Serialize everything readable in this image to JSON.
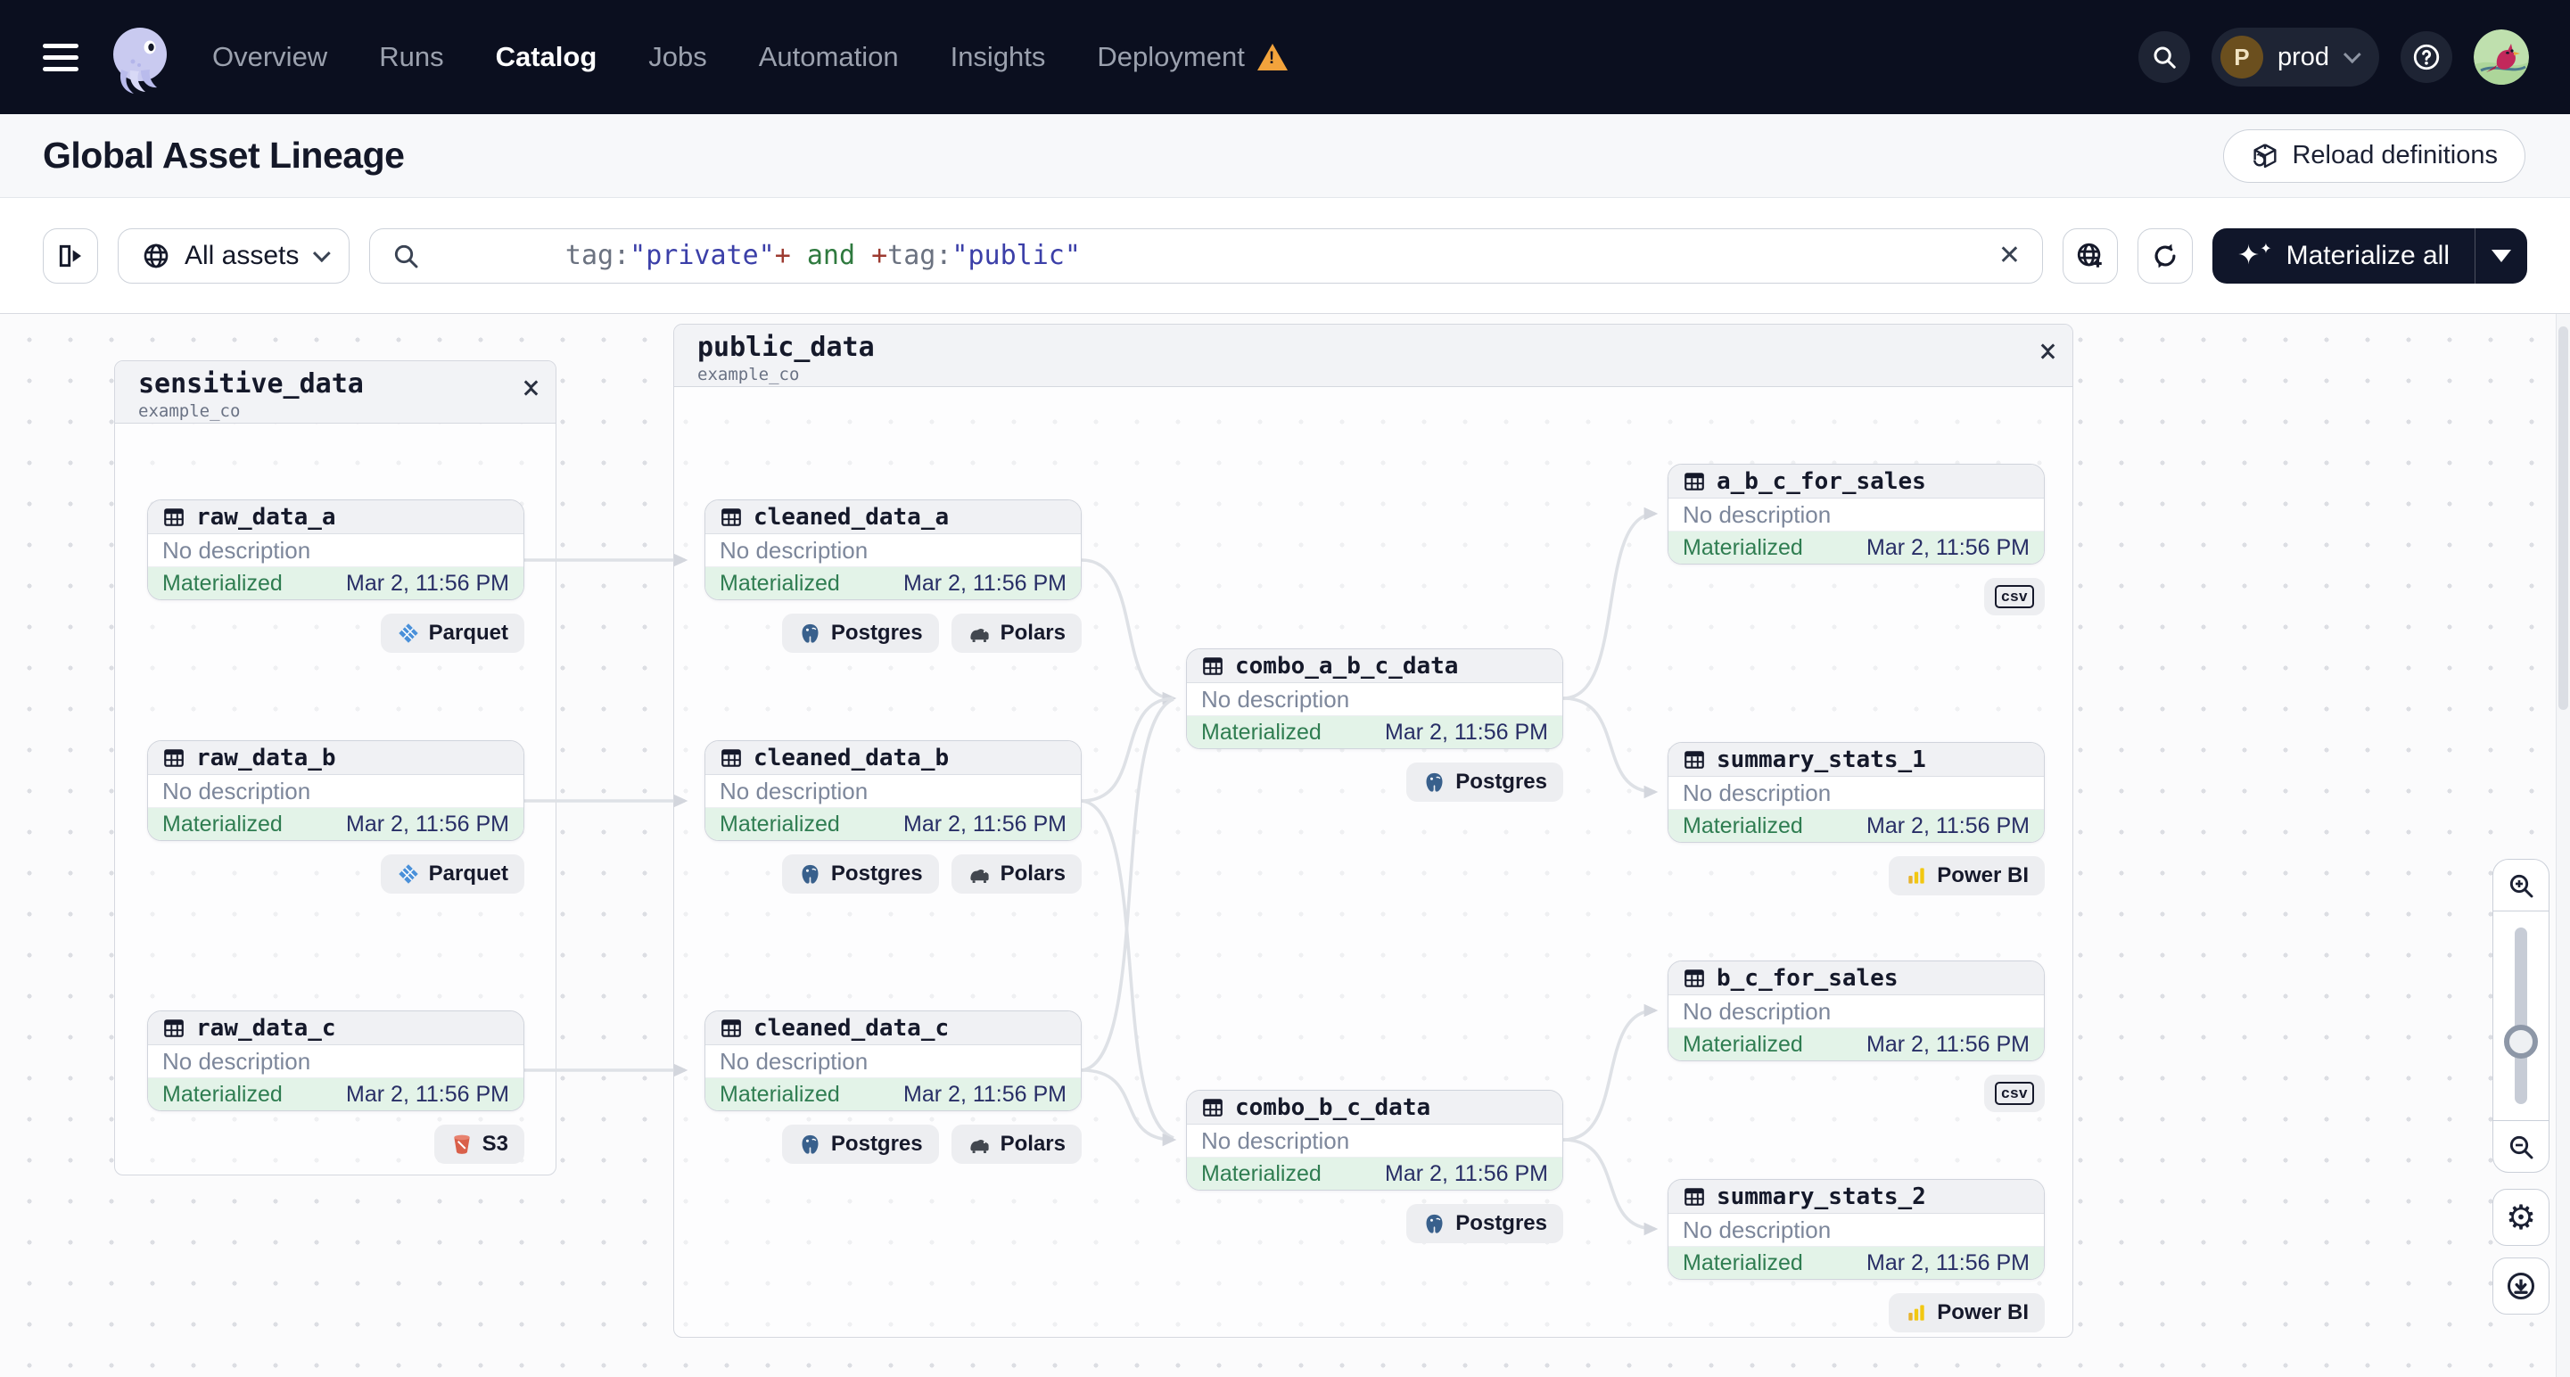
{
  "nav": {
    "items": [
      {
        "label": "Overview"
      },
      {
        "label": "Runs"
      },
      {
        "label": "Catalog"
      },
      {
        "label": "Jobs"
      },
      {
        "label": "Automation"
      },
      {
        "label": "Insights"
      },
      {
        "label": "Deployment"
      }
    ],
    "active": "Catalog",
    "env": {
      "initial": "P",
      "name": "prod"
    }
  },
  "header": {
    "title": "Global Asset Lineage",
    "reload_label": "Reload definitions"
  },
  "toolbar": {
    "scope_label": "All assets",
    "query": [
      {
        "text": "tag:",
        "color": "#6B7280"
      },
      {
        "text": "\"private\"",
        "color": "#3B3FA8"
      },
      {
        "text": "+",
        "color": "#9C3A30"
      },
      {
        "text": " and ",
        "color": "#2F7A3F"
      },
      {
        "text": "+",
        "color": "#9C3A30"
      },
      {
        "text": "tag:",
        "color": "#6B7280"
      },
      {
        "text": "\"public\"",
        "color": "#3B3FA8"
      }
    ],
    "clear_label": "✕",
    "materialize_label": "Materialize all"
  },
  "graph": {
    "groups": [
      {
        "name": "sensitive_data",
        "owner": "example_co"
      },
      {
        "name": "public_data",
        "owner": "example_co"
      }
    ],
    "nodes": [
      {
        "name": "raw_data_a",
        "description": "No description",
        "status": "Materialized",
        "timestamp": "Mar 2, 11:56 PM",
        "badges": [
          "Parquet"
        ]
      },
      {
        "name": "raw_data_b",
        "description": "No description",
        "status": "Materialized",
        "timestamp": "Mar 2, 11:56 PM",
        "badges": [
          "Parquet"
        ]
      },
      {
        "name": "raw_data_c",
        "description": "No description",
        "status": "Materialized",
        "timestamp": "Mar 2, 11:56 PM",
        "badges": [
          "S3"
        ]
      },
      {
        "name": "cleaned_data_a",
        "description": "No description",
        "status": "Materialized",
        "timestamp": "Mar 2, 11:56 PM",
        "badges": [
          "Postgres",
          "Polars"
        ]
      },
      {
        "name": "cleaned_data_b",
        "description": "No description",
        "status": "Materialized",
        "timestamp": "Mar 2, 11:56 PM",
        "badges": [
          "Postgres",
          "Polars"
        ]
      },
      {
        "name": "cleaned_data_c",
        "description": "No description",
        "status": "Materialized",
        "timestamp": "Mar 2, 11:56 PM",
        "badges": [
          "Postgres",
          "Polars"
        ]
      },
      {
        "name": "combo_a_b_c_data",
        "description": "No description",
        "status": "Materialized",
        "timestamp": "Mar 2, 11:56 PM",
        "badges": [
          "Postgres"
        ]
      },
      {
        "name": "combo_b_c_data",
        "description": "No description",
        "status": "Materialized",
        "timestamp": "Mar 2, 11:56 PM",
        "badges": [
          "Postgres"
        ]
      },
      {
        "name": "a_b_c_for_sales",
        "description": "No description",
        "status": "Materialized",
        "timestamp": "Mar 2, 11:56 PM",
        "badges": [
          "csv"
        ]
      },
      {
        "name": "summary_stats_1",
        "description": "No description",
        "status": "Materialized",
        "timestamp": "Mar 2, 11:56 PM",
        "badges": [
          "Power BI"
        ]
      },
      {
        "name": "b_c_for_sales",
        "description": "No description",
        "status": "Materialized",
        "timestamp": "Mar 2, 11:56 PM",
        "badges": [
          "csv"
        ]
      },
      {
        "name": "summary_stats_2",
        "description": "No description",
        "status": "Materialized",
        "timestamp": "Mar 2, 11:56 PM",
        "badges": [
          "Power BI"
        ]
      }
    ]
  },
  "colors": {
    "nav_bg": "#0B0F1F",
    "status_green": "#2F7D51",
    "timestamp_navy": "#282E66",
    "warning_orange": "#F2A33C",
    "edge_gray": "#DEE1E6"
  }
}
